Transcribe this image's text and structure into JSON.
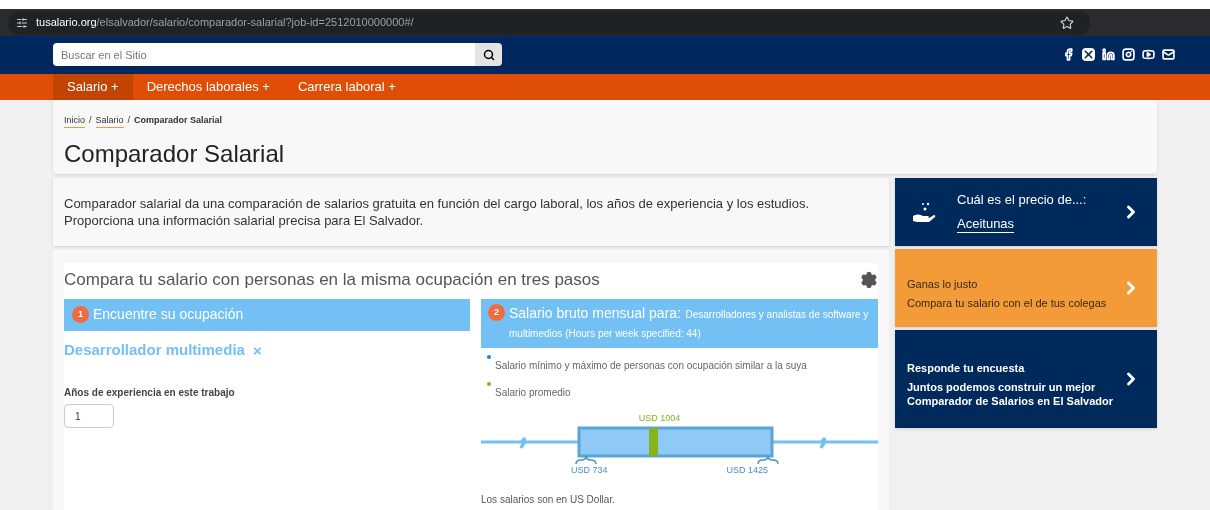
{
  "browser": {
    "url_host": "tusalario.org",
    "url_path": "/elsalvador/salario/comparador-salarial?job-id=2512010000000#/"
  },
  "header": {
    "search": {
      "placeholder": "Buscar en el Sitio"
    }
  },
  "nav": [
    {
      "label": "Salario +",
      "selected": true
    },
    {
      "label": "Derechos laborales +",
      "selected": false
    },
    {
      "label": "Carrera laboral +",
      "selected": false
    }
  ],
  "breadcrumb": [
    {
      "label": "Inicio",
      "kind": "link"
    },
    {
      "label": "/",
      "kind": "separator"
    },
    {
      "label": "Salario",
      "kind": "link"
    },
    {
      "label": "/",
      "kind": "separator"
    },
    {
      "label": "Comparador Salarial",
      "kind": "current"
    }
  ],
  "title": "Comparador Salarial",
  "intro": "Comparador salarial da una comparación de salarios gratuita en función del cargo laboral, los años de experiencia y los estudios. Proporciona una información salarial precisa para El Salvador.",
  "tool": {
    "title": "Compara tu salario con personas en la misma ocupación en tres pasos",
    "step1": {
      "number": "1",
      "title": "Encuentre su ocupación",
      "occupation": "Desarrollador multimedia",
      "remove": "×",
      "experience_label": "Años de experiencia en este trabajo",
      "experience_value": "1"
    },
    "step2": {
      "number": "2",
      "title": "Salario bruto mensual para:",
      "subtitle": "Desarrolladores y analistas de software y multimedios (Hours per week specified: 44)",
      "legend": [
        {
          "label": "Salario mínimo y máximo de personas con ocupación similar a la suya",
          "color": "#1e88d0"
        },
        {
          "label": "Salario promedio",
          "color": "#86b21c"
        }
      ],
      "average": "USD 1004",
      "minimum": "USD 734",
      "maximum": "USD 1425"
    },
    "note": "Los salarios son en US Dollar."
  },
  "sidebar": [
    {
      "kind": "price",
      "title": "Cuál es el precio de...:",
      "link": "Aceitunas"
    },
    {
      "kind": "orange",
      "title": "Ganas lo justo",
      "text": "Compara tu salario con el de tus colegas"
    },
    {
      "kind": "navy",
      "title": "Responde tu encuesta",
      "text": "Juntos podemos construir un mejor Comparador de Salarios en El Salvador"
    }
  ]
}
